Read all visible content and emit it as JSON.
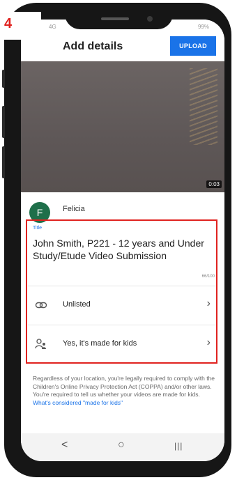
{
  "step_badge": "4",
  "status_bar": {
    "left": "4G",
    "right": "99%"
  },
  "header": {
    "title": "Add details",
    "upload_label": "UPLOAD"
  },
  "video": {
    "duration": "0:03"
  },
  "channel": {
    "avatar_letter": "F",
    "name": "Felicia"
  },
  "form": {
    "title_label": "Title",
    "title_value": "John Smith, P221 - 12 years and Under Study/Etude Video Submission",
    "char_count": "66/100",
    "visibility": "Unlisted",
    "audience": "Yes, it's made for kids"
  },
  "disclaimer": {
    "text": "Regardless of your location, you're legally required to comply with the Children's Online Privacy Protection Act (COPPA) and/or other laws. You're required to tell us whether your videos are made for kids.",
    "link": "What's considered \"made for kids\""
  },
  "nav": {
    "back": "<",
    "home": "○",
    "recents": "|||"
  },
  "icons": {
    "visibility": "link-icon",
    "audience": "person-kids-icon",
    "chevron": "chevron-right-icon"
  },
  "colors": {
    "accent": "#1a73e8",
    "highlight": "#e0221f",
    "avatar": "#1e6f4a"
  }
}
